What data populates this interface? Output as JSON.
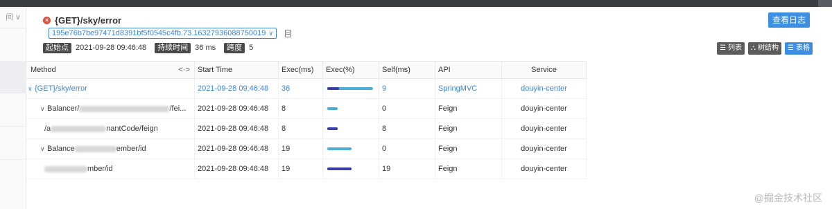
{
  "left_pane": {
    "header": "间 ∨"
  },
  "header": {
    "title": "{GET}/sky/error",
    "trace_id": "195e76b7be97471d8391bf5f0545c4fb.73.16327936088750019",
    "view_log_button": "查看日志"
  },
  "meta": {
    "start_label": "起始点",
    "start_value": "2021-09-28 09:46:48",
    "duration_label": "持续时间",
    "duration_value": "36 ms",
    "span_label": "跨度",
    "span_value": "5"
  },
  "view_buttons": [
    {
      "label": "列表",
      "icon": "list-icon"
    },
    {
      "label": "树结构",
      "icon": "tree-icon"
    },
    {
      "label": "表格",
      "icon": "table-icon",
      "active": true
    }
  ],
  "table": {
    "columns": [
      "Method",
      "Start Time",
      "Exec(ms)",
      "Exec(%)",
      "Self(ms)",
      "API",
      "Service"
    ],
    "method_resize_icon": "<·>",
    "rows": [
      {
        "method": "{GET}/sky/error",
        "start": "2021-09-28 09:46:48",
        "exec": "36",
        "self": "9",
        "api": "SpringMVC",
        "service": "douyin-center",
        "exec_pct": 1.0,
        "self_pct": 0.25
      },
      {
        "method_pre": "Balancer/",
        "method_post": "/fei...",
        "start": "2021-09-28 09:46:48",
        "exec": "8",
        "self": "0",
        "api": "Feign",
        "service": "douyin-center",
        "exec_pct": 0.22,
        "self_pct": 0.0
      },
      {
        "method_pre": "/a",
        "method_post": "nantCode/feign",
        "start": "2021-09-28 09:46:48",
        "exec": "8",
        "self": "8",
        "api": "Feign",
        "service": "douyin-center",
        "exec_pct": 0.22,
        "self_pct": 0.22
      },
      {
        "method_pre": "Balance",
        "method_post": "ember/id",
        "start": "2021-09-28 09:46:48",
        "exec": "19",
        "self": "0",
        "api": "Feign",
        "service": "douyin-center",
        "exec_pct": 0.53,
        "self_pct": 0.0
      },
      {
        "method_pre": "",
        "method_post": "mber/id",
        "start": "2021-09-28 09:46:48",
        "exec": "19",
        "self": "19",
        "api": "Feign",
        "service": "douyin-center",
        "exec_pct": 0.53,
        "self_pct": 0.53
      }
    ]
  },
  "watermark": "@掘金技术社区"
}
